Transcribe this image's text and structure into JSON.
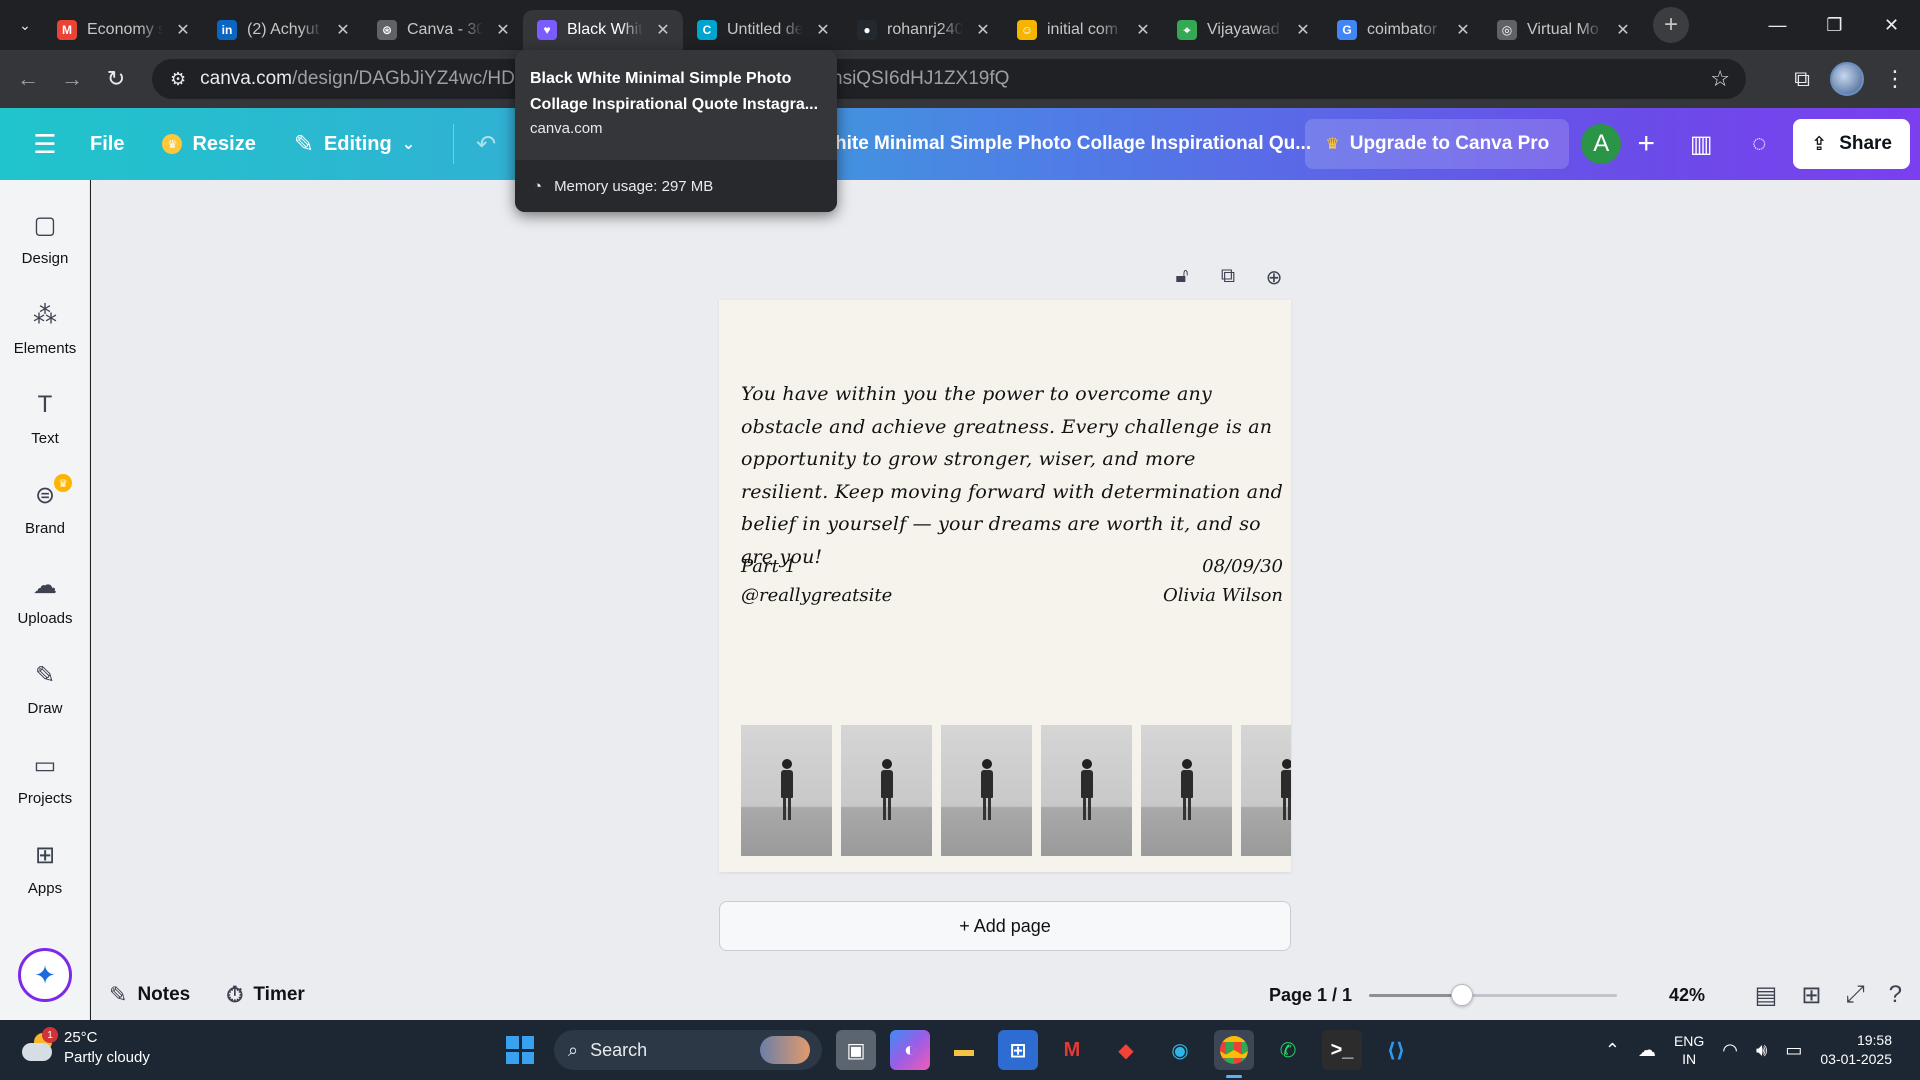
{
  "browser": {
    "tabs": [
      {
        "title": "Economy s",
        "favicon": "gmail-icon",
        "color": "#ea4335",
        "glyph": "M"
      },
      {
        "title": "(2) Achyut",
        "favicon": "linkedin-icon",
        "color": "#0a66c2",
        "glyph": "in"
      },
      {
        "title": "Canva - 30",
        "favicon": "chatgpt-icon",
        "color": "#5f6368",
        "glyph": "⊛"
      },
      {
        "title": "Black Whit",
        "favicon": "canva-heart-icon",
        "color": "#7b5cff",
        "glyph": "♥",
        "active": true
      },
      {
        "title": "Untitled de",
        "favicon": "canva-icon",
        "color": "#00a5cf",
        "glyph": "C"
      },
      {
        "title": "rohanrj240",
        "favicon": "github-icon",
        "color": "#24292f",
        "glyph": "●"
      },
      {
        "title": "initial com",
        "favicon": "emoji-icon",
        "color": "#f4b400",
        "glyph": "☺"
      },
      {
        "title": "Vijayawad",
        "favicon": "maps-icon",
        "color": "#34a853",
        "glyph": "⌖"
      },
      {
        "title": "coimbator",
        "favicon": "google-icon",
        "color": "#4285f4",
        "glyph": "G"
      },
      {
        "title": "Virtual Mo",
        "favicon": "globe-icon",
        "color": "#5f6368",
        "glyph": "◎"
      }
    ],
    "url_domain": "canva.com",
    "url_path": "/design/DAGbJiYZ4wc/HDowB",
    "url_tail": "nsiQSI6dHJ1ZX19fQ",
    "hovercard": {
      "title": "Black White Minimal Simple Photo Collage Inspirational Quote Instagra...",
      "domain": "canva.com",
      "memory": "Memory usage: 297 MB"
    }
  },
  "canva": {
    "menu_file": "File",
    "resize": "Resize",
    "editing": "Editing",
    "doc_title": "hite Minimal Simple Photo Collage Inspirational Qu...",
    "upgrade": "Upgrade to Canva Pro",
    "avatar_initial": "A",
    "share": "Share",
    "sidebar": [
      {
        "label": "Design",
        "icon": "▢"
      },
      {
        "label": "Elements",
        "icon": "⁂"
      },
      {
        "label": "Text",
        "icon": "T"
      },
      {
        "label": "Brand",
        "icon": "⊜"
      },
      {
        "label": "Uploads",
        "icon": "☁"
      },
      {
        "label": "Draw",
        "icon": "✎"
      },
      {
        "label": "Projects",
        "icon": "▭"
      },
      {
        "label": "Apps",
        "icon": "⊞"
      }
    ],
    "quote": "You have within you the power to overcome any obstacle and achieve greatness. Every challenge is an opportunity to grow stronger, wiser, and more resilient. Keep moving forward with determination and belief in yourself — your dreams are worth it, and so are you!",
    "part": "Part 1",
    "handle": "@reallygreatsite",
    "date": "08/09/30",
    "author": "Olivia Wilson",
    "add_page": "+ Add page",
    "notes": "Notes",
    "timer": "Timer",
    "page_label": "Page 1 / 1",
    "zoom_label": "42%",
    "zoom_fraction": 0.375
  },
  "taskbar": {
    "temp": "25°C",
    "weather": "Partly cloudy",
    "weather_badge": "1",
    "search": "Search",
    "lang1": "ENG",
    "lang2": "IN",
    "time": "19:58",
    "date": "03-01-2025"
  }
}
